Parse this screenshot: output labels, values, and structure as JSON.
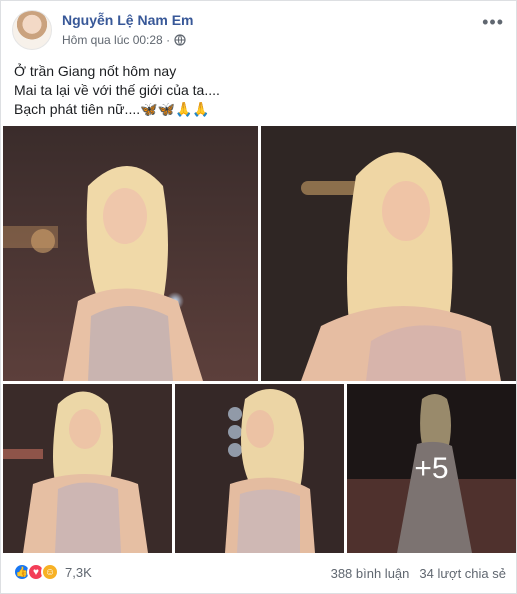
{
  "post": {
    "author": "Nguyễn Lệ Nam Em",
    "time": "Hôm qua lúc 00:28 ·",
    "caption": [
      "Ở trần Giang nốt hôm nay",
      "Mai ta lại về với thế giới của ta....",
      "Bạch phát tiên nữ....🦋🦋🙏🙏"
    ],
    "more_photos": "+5",
    "reactions_count": "7,3K",
    "comments": "388 bình luận",
    "shares": "34 lượt chia sẻ",
    "icons": {
      "more": "more-options-icon",
      "privacy": "globe-icon",
      "reactions": [
        "like-icon",
        "love-icon",
        "haha-icon"
      ]
    },
    "colors": {
      "author": "#385898",
      "like": "#1877f2",
      "love": "#f33e58",
      "haha": "#f7b125"
    }
  }
}
